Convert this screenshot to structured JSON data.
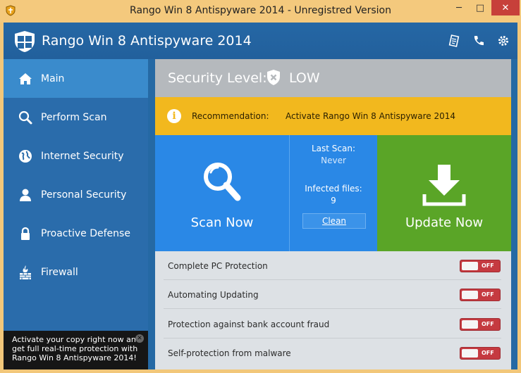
{
  "window": {
    "title": "Rango Win 8 Antispyware 2014 - Unregistred Version",
    "minimize": "─",
    "maximize": "□",
    "close": "✕"
  },
  "header": {
    "app_name": "Rango Win 8 Antispyware 2014",
    "icons": [
      "document-icon",
      "phone-icon",
      "gear-icon"
    ]
  },
  "sidebar": {
    "items": [
      {
        "label": "Main",
        "icon": "home-icon",
        "active": true
      },
      {
        "label": "Perform Scan",
        "icon": "search-icon",
        "active": false
      },
      {
        "label": "Internet Security",
        "icon": "globe-icon",
        "active": false
      },
      {
        "label": "Personal Security",
        "icon": "person-icon",
        "active": false
      },
      {
        "label": "Proactive Defense",
        "icon": "lock-icon",
        "active": false
      },
      {
        "label": "Firewall",
        "icon": "firewall-icon",
        "active": false
      }
    ],
    "promo": {
      "text": "Activate your copy right now and get full real-time protection with Rango Win 8 Antispyware 2014!",
      "close": "✕"
    }
  },
  "security": {
    "label": "Security Level:",
    "value": "LOW"
  },
  "recommendation": {
    "icon": "i",
    "label": "Recommendation:",
    "value": "Activate Rango Win 8 Antispyware 2014"
  },
  "scan": {
    "label": "Scan Now"
  },
  "info": {
    "last_scan_label": "Last Scan:",
    "last_scan_value": "Never",
    "infected_label": "Infected files:",
    "infected_value": "9",
    "clean_label": "Clean"
  },
  "update": {
    "label": "Update Now"
  },
  "settings": [
    {
      "label": "Complete PC Protection",
      "state": "OFF"
    },
    {
      "label": "Automating Updating",
      "state": "OFF"
    },
    {
      "label": "Protection against bank account fraud",
      "state": "OFF"
    },
    {
      "label": "Self-protection from malware",
      "state": "OFF"
    }
  ],
  "colors": {
    "title_bar": "#f4c97d",
    "header": "#2567a5",
    "sidebar": "#2a6cab",
    "sidebar_active": "#3a8bcc",
    "scan_tile": "#2a88e6",
    "update_tile": "#5aa527",
    "recommendation": "#f2b81e",
    "toggle_off": "#c53a40"
  }
}
